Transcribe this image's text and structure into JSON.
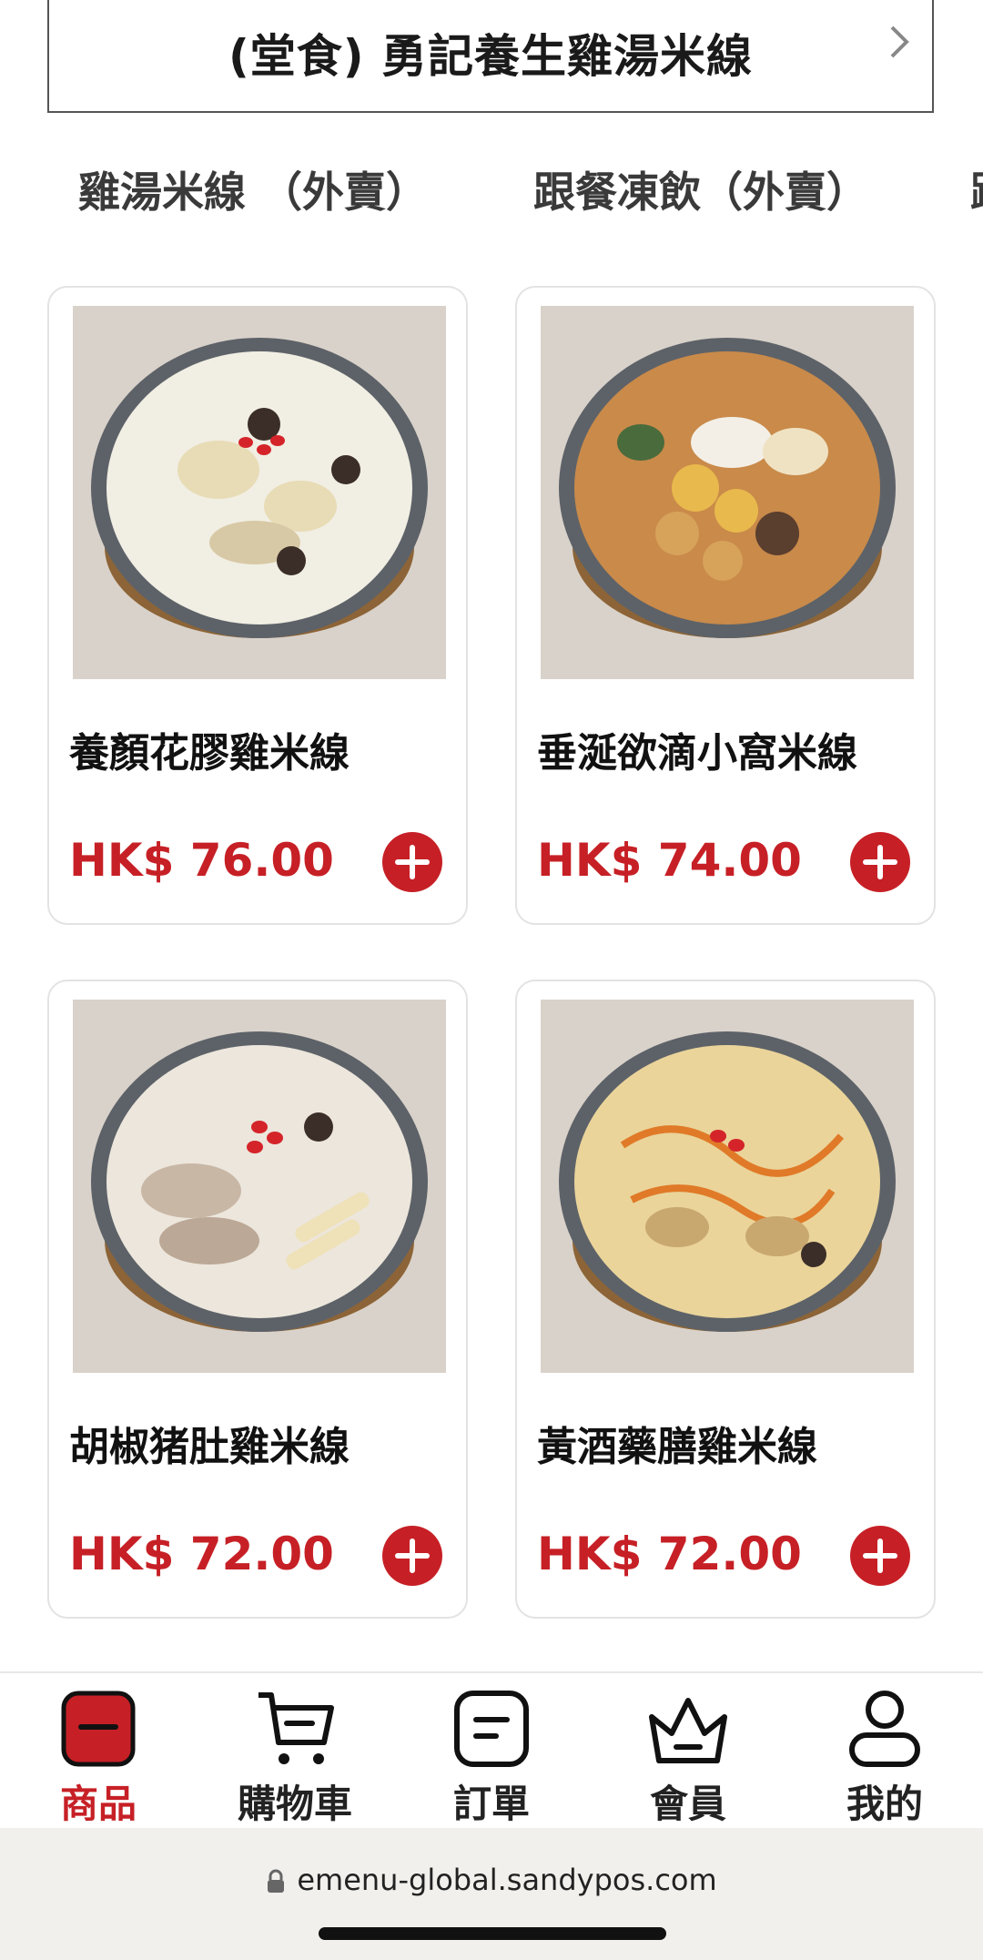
{
  "store": {
    "title": "(堂食) 勇記養生雞湯米線"
  },
  "categories": [
    "雞湯米線 （外賣）",
    "跟餐凍飲（外賣）",
    "跟"
  ],
  "products": [
    {
      "name": "養顏花膠雞米線",
      "price": "HK$ 76.00"
    },
    {
      "name": "垂涎欲滴小窩米線",
      "price": "HK$ 74.00"
    },
    {
      "name": "胡椒猪肚雞米線",
      "price": "HK$ 72.00"
    },
    {
      "name": "黃酒藥膳雞米線",
      "price": "HK$ 72.00"
    }
  ],
  "nav": {
    "items": [
      {
        "label": "商品",
        "icon": "product-icon"
      },
      {
        "label": "購物車",
        "icon": "cart-icon"
      },
      {
        "label": "訂單",
        "icon": "order-icon"
      },
      {
        "label": "會員",
        "icon": "crown-icon"
      },
      {
        "label": "我的",
        "icon": "user-icon"
      }
    ],
    "active_color": "#c62026"
  },
  "browser": {
    "url": "emenu-global.sandypos.com"
  },
  "colors": {
    "accent": "#c62026"
  }
}
